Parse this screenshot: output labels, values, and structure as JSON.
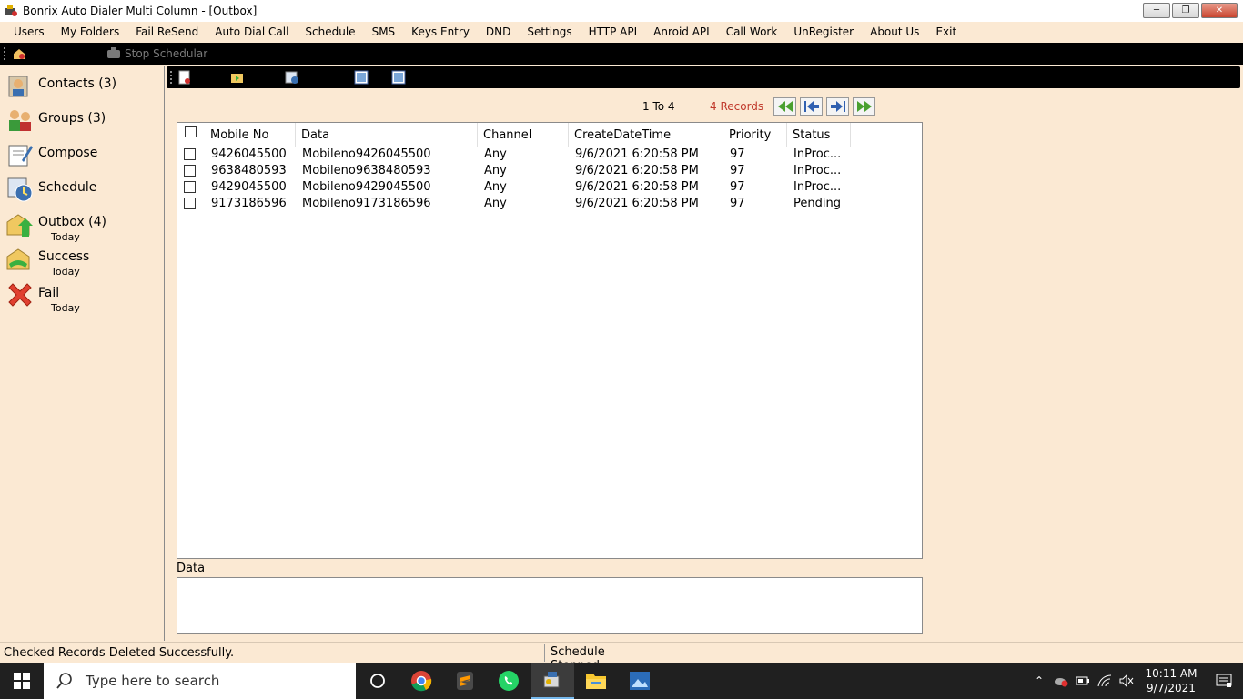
{
  "window": {
    "title": "Bonrix Auto Dialer Multi Column - [Outbox]"
  },
  "menu": [
    "Users",
    "My Folders",
    "Fail ReSend",
    "Auto Dial Call",
    "Schedule",
    "SMS",
    "Keys Entry",
    "DND",
    "Settings",
    "HTTP API",
    "Anroid API",
    "Call Work",
    "UnRegister",
    "About Us",
    "Exit"
  ],
  "toolbar": {
    "stop_scheduler": "Stop Schedular"
  },
  "sidebar": {
    "items": [
      {
        "label": "Contacts (3)",
        "sub": ""
      },
      {
        "label": "Groups (3)",
        "sub": ""
      },
      {
        "label": "Compose",
        "sub": ""
      },
      {
        "label": "Schedule",
        "sub": ""
      },
      {
        "label": "Outbox (4)",
        "sub": "Today"
      },
      {
        "label": "Success",
        "sub": "Today"
      },
      {
        "label": "Fail",
        "sub": "Today"
      }
    ]
  },
  "pager": {
    "range": "1 To  4",
    "records": "4 Records"
  },
  "table": {
    "headers": [
      "Mobile No",
      "Data",
      "Channel",
      "CreateDateTime",
      "Priority",
      "Status"
    ],
    "rows": [
      [
        "9426045500",
        "Mobileno9426045500",
        "Any",
        "9/6/2021 6:20:58 PM",
        "97",
        "InProc..."
      ],
      [
        "9638480593",
        "Mobileno9638480593",
        "Any",
        "9/6/2021 6:20:58 PM",
        "97",
        "InProc..."
      ],
      [
        "9429045500",
        "Mobileno9429045500",
        "Any",
        "9/6/2021 6:20:58 PM",
        "97",
        "InProc..."
      ],
      [
        "9173186596",
        "Mobileno9173186596",
        "Any",
        "9/6/2021 6:20:58 PM",
        "97",
        "Pending"
      ]
    ]
  },
  "data_panel": {
    "label": "Data"
  },
  "status": {
    "left": "Checked Records Deleted Successfully.",
    "middle": "Schedule Stopped....."
  },
  "taskbar": {
    "search_placeholder": "Type here to search",
    "time": "10:11 AM",
    "date": "9/7/2021"
  },
  "colors": {
    "background": "#fbe9d3",
    "toolbar": "#000000",
    "records_text": "#c0392b"
  }
}
